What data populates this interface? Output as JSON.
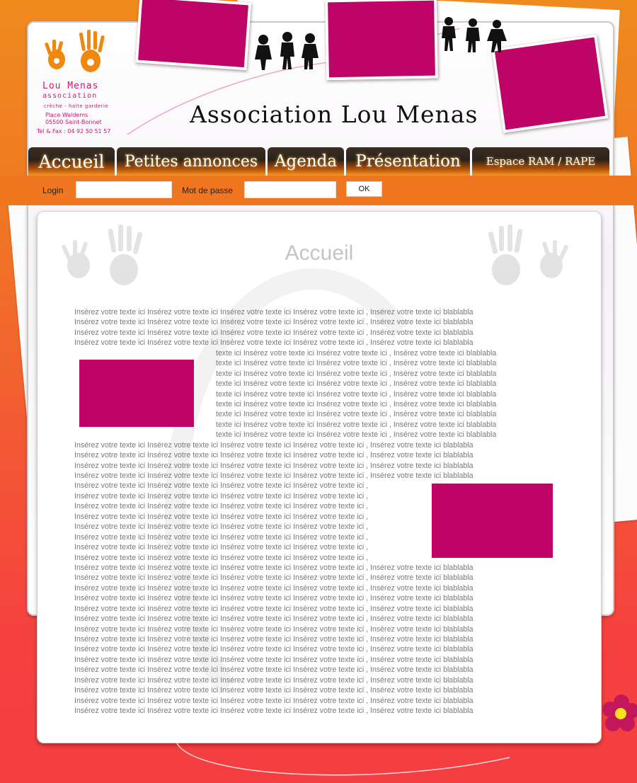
{
  "site": {
    "title": "Association Lou Menas",
    "logo": {
      "name": "Lou Menas",
      "subtitle": "association",
      "description": "crèche - halte garderie",
      "address_line1": "Place Waldems",
      "address_line2": "05500 Saint-Bonnet",
      "phone": "Tel & Fax : 04 92 50 51 57"
    }
  },
  "nav": {
    "items": [
      {
        "label": "Accueil"
      },
      {
        "label": "Petites annonces"
      },
      {
        "label": "Agenda"
      },
      {
        "label": "Présentation"
      },
      {
        "label": "Espace RAM / RAPE"
      }
    ]
  },
  "login": {
    "login_label": "Login",
    "login_value": "",
    "password_label": "Mot de passe",
    "password_value": "",
    "ok_label": "OK"
  },
  "page": {
    "heading": "Accueil",
    "line_full": "Insérez votre texte ici Insérez votre texte ici Insérez votre texte ici Insérez votre texte ici , Insérez votre texte ici  blablabla",
    "line_right": "texte ici Insérez votre texte ici Insérez votre texte ici , Insérez votre texte ici  blablabla",
    "line_left": "Insérez votre texte ici Insérez votre texte ici Insérez votre texte ici Insérez votre texte ici ,"
  },
  "colors": {
    "accent": "#bf0468",
    "orange": "#f07720",
    "red": "#f43d41"
  }
}
